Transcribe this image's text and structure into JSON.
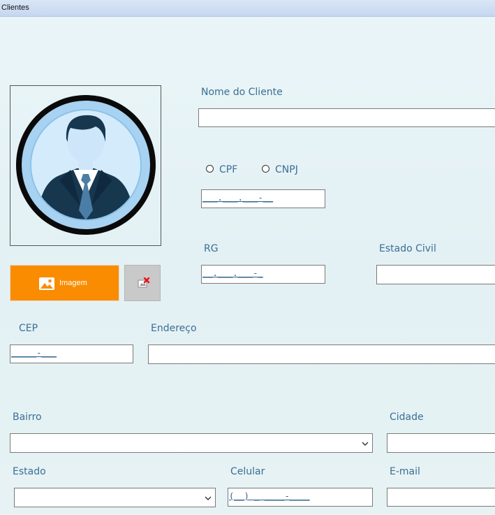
{
  "window": {
    "title": "Clientes"
  },
  "photo": {
    "upload_label": "Imagem"
  },
  "form": {
    "nome_label": "Nome do Cliente",
    "cpf_label": "CPF",
    "cnpj_label": "CNPJ",
    "cpf_mask": "___.___.___-__",
    "rg_label": "RG",
    "rg_mask": "__.___.___-_",
    "estado_civil_label": "Estado Civil",
    "cep_label": "CEP",
    "cep_mask": "_____-___",
    "endereco_label": "Endereço",
    "bairro_label": "Bairro",
    "cidade_label": "Cidade",
    "estado_label": "Estado",
    "celular_label": "Celular",
    "celular_mask": "(__) _ ____-____",
    "email_label": "E-mail"
  },
  "icons": {
    "upload": "image-icon",
    "remove": "remove-image-icon",
    "dropdown": "chevron-down-icon"
  },
  "colors": {
    "accent": "#f98c00",
    "label": "#3b6e95",
    "remove_button": "#c9c9c9",
    "remove_x": "#e8101a"
  }
}
